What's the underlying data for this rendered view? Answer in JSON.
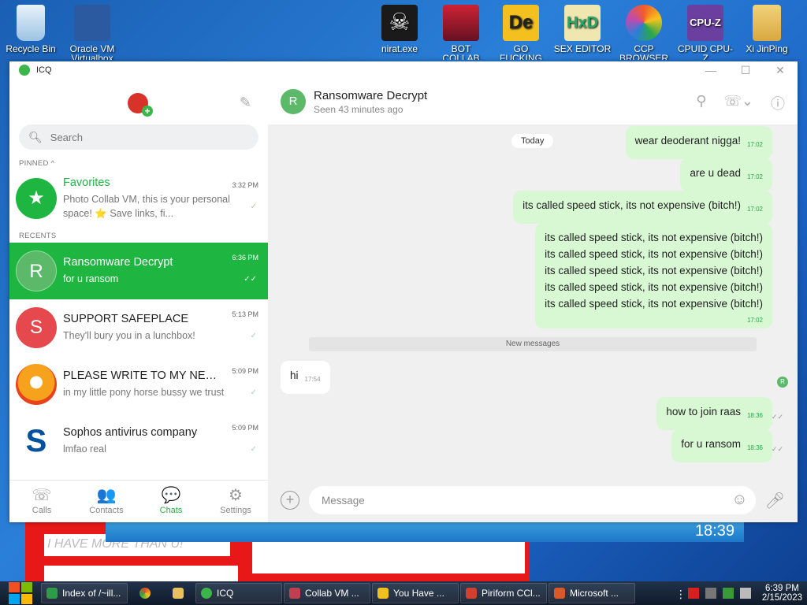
{
  "desktop": {
    "icons": [
      {
        "label": "Recycle Bin",
        "name": "recycle-bin-icon",
        "color": "#cfe5f5"
      },
      {
        "label": "Oracle VM Virtualbox",
        "name": "virtualbox-icon",
        "color": "#2c5aa0"
      },
      {
        "label": "nirat.exe",
        "name": "skull-icon",
        "color": "#222222"
      },
      {
        "label": "BOT COLLAB",
        "name": "bot-collab-icon",
        "color": "#cc2233"
      },
      {
        "label": "GO FUCKING DIE WHORE",
        "name": "die-icon",
        "color": "#f4c020"
      },
      {
        "label": "SEX EDITOR",
        "name": "hxd-icon",
        "color": "#f0e080"
      },
      {
        "label": "CCP BROWSER",
        "name": "chrome-like-icon",
        "color": "#f25b2a"
      },
      {
        "label": "CPUID CPU-Z",
        "name": "cpuz-icon",
        "color": "#6a3fa0"
      },
      {
        "label": "Xi JinPing",
        "name": "folder-user-icon",
        "color": "#e8c060"
      }
    ],
    "bg_text": "I HAVE MORE THAN U!",
    "strip_time": "18:39"
  },
  "window": {
    "title": "ICQ",
    "controls": [
      "—",
      "☐",
      "✕"
    ]
  },
  "sidebar": {
    "search_placeholder": "Search",
    "pinned_label": "PINNED ^",
    "recents_label": "RECENTS",
    "chats": [
      {
        "name": "Favorites",
        "preview": "Photo Collab VM, this is your personal space! ⭐ Save links, fi...",
        "time": "3:32 PM",
        "avatar": "★",
        "color": "#1fb541",
        "pinned": true
      },
      {
        "name": "Ransomware Decrypt",
        "preview": "for u ransom",
        "time": "6:36 PM",
        "avatar": "R",
        "color": "#5cb96a",
        "active": true
      },
      {
        "name": "SUPPORT SAFEPLACE",
        "preview": "They'll bury you in a lunchbox!",
        "time": "5:13 PM",
        "avatar": "S",
        "color": "#e5484d"
      },
      {
        "name": "PLEASE WRITE TO MY NEW IC...",
        "preview": "in my little pony horse bussy we trust",
        "time": "5:09 PM",
        "avatar": "",
        "color": "#f08a1c"
      },
      {
        "name": "Sophos antivirus company",
        "preview": "lmfao real",
        "time": "5:09 PM",
        "avatar": "S",
        "color": "#ffffff"
      }
    ]
  },
  "nav": {
    "tabs": [
      {
        "label": "Calls",
        "icon": "☏"
      },
      {
        "label": "Contacts",
        "icon": "👥"
      },
      {
        "label": "Chats",
        "icon": "💬"
      },
      {
        "label": "Settings",
        "icon": "⚙"
      }
    ]
  },
  "conversation": {
    "title": "Ransomware Decrypt",
    "status": "Seen 43 minutes ago",
    "avatar": "R",
    "day": "Today",
    "new_messages": "New messages",
    "messages": [
      {
        "text": "wear deoderant nigga!",
        "time": "17:02",
        "dir": "out"
      },
      {
        "text": "are u dead",
        "time": "17:02",
        "dir": "out"
      },
      {
        "text": "its called speed stick, its not expensive (bitch!)",
        "time": "17:02",
        "dir": "out"
      },
      {
        "lines": [
          "its called speed stick, its not expensive (bitch!)",
          "its called speed stick, its not expensive (bitch!)",
          "its called speed stick, its not expensive (bitch!)",
          "its called speed stick, its not expensive (bitch!)",
          "its called speed stick, its not expensive (bitch!)"
        ],
        "time": "17:02",
        "dir": "out"
      },
      {
        "text": "hi",
        "time": "17:54",
        "dir": "in"
      },
      {
        "text": "how to join raas",
        "time": "18:36",
        "dir": "out"
      },
      {
        "text": "for u ransom",
        "time": "18:36",
        "dir": "out"
      }
    ],
    "read_badge": "R",
    "composer_placeholder": "Message"
  },
  "taskbar": {
    "items": [
      {
        "label": "Index of /~ill...",
        "color": "#2e9b4a"
      },
      {
        "label": "",
        "color": "#e04a2a",
        "icon": true
      },
      {
        "label": "",
        "color": "#e8c060",
        "icon": true
      },
      {
        "label": "ICQ",
        "color": "#3cb54a"
      },
      {
        "label": "Collab VM ...",
        "color": "#c04050"
      },
      {
        "label": "You Have ...",
        "color": "#f0c020"
      },
      {
        "label": "Piriform CCl...",
        "color": "#d04030"
      },
      {
        "label": "Microsoft ...",
        "color": "#d85a2a"
      }
    ],
    "time": "6:39 PM",
    "date": "2/15/2023"
  }
}
